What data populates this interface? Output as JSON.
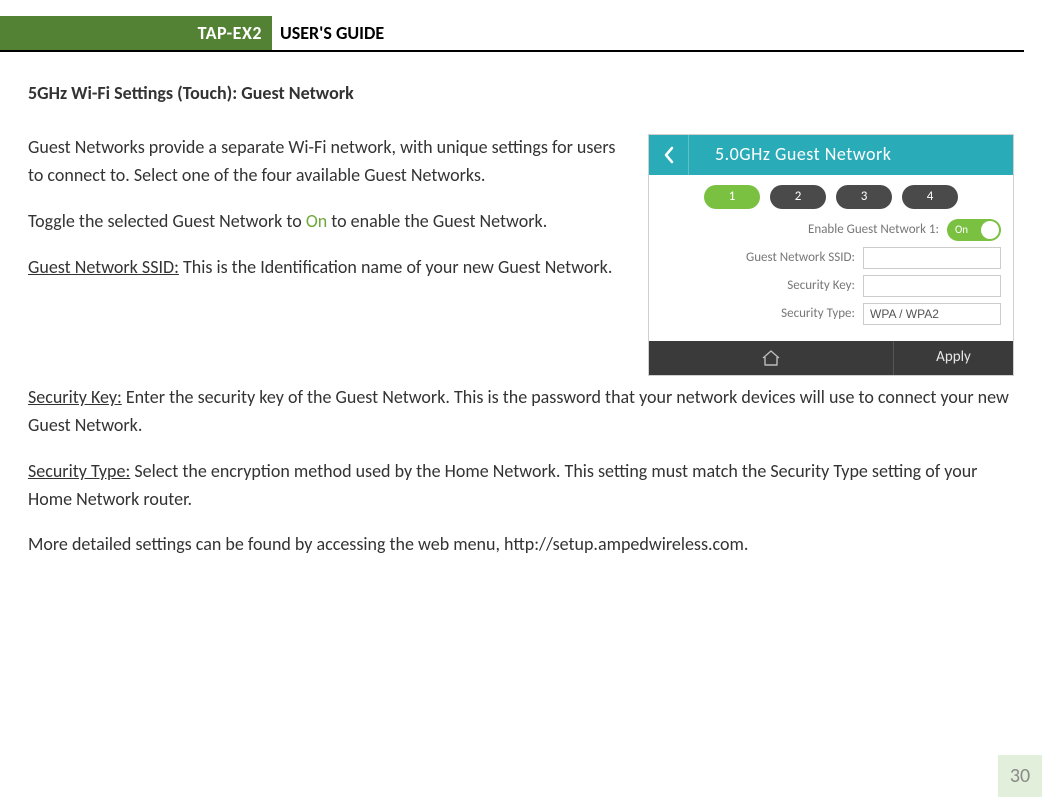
{
  "header": {
    "badge": "TAP-EX2",
    "title": "USER'S GUIDE"
  },
  "section_heading": "5GHz Wi-Fi Settings (Touch): Guest Network",
  "paragraphs": {
    "p1": "Guest Networks provide a separate Wi-Fi network, with unique settings for users to connect to.  Select one of the four available Guest Networks.",
    "p2a": "Toggle the selected Guest Network to ",
    "p2_on": "On",
    "p2b": " to enable the Guest Network.",
    "p3_label": "Guest Network SSID:",
    "p3_text": " This is the Identification name of your new Guest Network.",
    "p4_label": "Security Key:",
    "p4_text": " Enter the security key of the Guest Network. This is the password that your network devices will use to connect your new Guest Network.",
    "p5_label": "Security Type:",
    "p5_text": " Select the encryption method used by the Home Network. This setting must match the Security Type setting of your Home Network router.",
    "p6": "More detailed settings can be found by accessing the web menu, http://setup.ampedwireless.com."
  },
  "touch": {
    "title": "5.0GHz Guest Network",
    "tabs": [
      "1",
      "2",
      "3",
      "4"
    ],
    "enable_label": "Enable Guest Network 1:",
    "toggle_text": "On",
    "ssid_label": "Guest Network SSID:",
    "ssid_value": "",
    "key_label": "Security Key:",
    "key_value": "",
    "type_label": "Security Type:",
    "type_value": "WPA / WPA2",
    "apply": "Apply"
  },
  "page_number": "30"
}
